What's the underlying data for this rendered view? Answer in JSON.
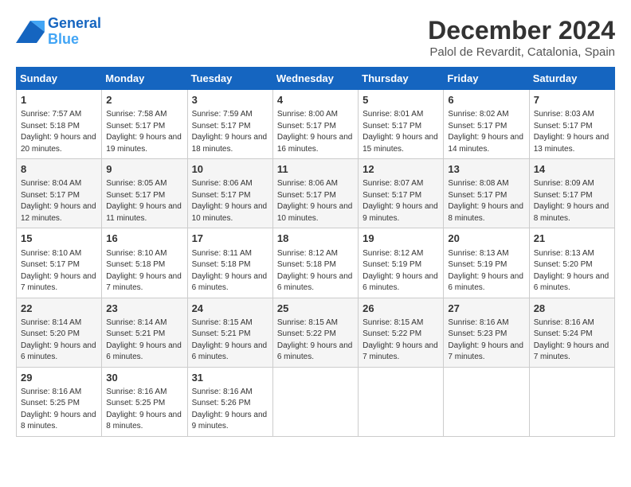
{
  "logo": {
    "line1": "General",
    "line2": "Blue"
  },
  "title": "December 2024",
  "subtitle": "Palol de Revardit, Catalonia, Spain",
  "days_of_week": [
    "Sunday",
    "Monday",
    "Tuesday",
    "Wednesday",
    "Thursday",
    "Friday",
    "Saturday"
  ],
  "weeks": [
    [
      {
        "day": "1",
        "info": "Sunrise: 7:57 AM\nSunset: 5:18 PM\nDaylight: 9 hours and 20 minutes."
      },
      {
        "day": "2",
        "info": "Sunrise: 7:58 AM\nSunset: 5:17 PM\nDaylight: 9 hours and 19 minutes."
      },
      {
        "day": "3",
        "info": "Sunrise: 7:59 AM\nSunset: 5:17 PM\nDaylight: 9 hours and 18 minutes."
      },
      {
        "day": "4",
        "info": "Sunrise: 8:00 AM\nSunset: 5:17 PM\nDaylight: 9 hours and 16 minutes."
      },
      {
        "day": "5",
        "info": "Sunrise: 8:01 AM\nSunset: 5:17 PM\nDaylight: 9 hours and 15 minutes."
      },
      {
        "day": "6",
        "info": "Sunrise: 8:02 AM\nSunset: 5:17 PM\nDaylight: 9 hours and 14 minutes."
      },
      {
        "day": "7",
        "info": "Sunrise: 8:03 AM\nSunset: 5:17 PM\nDaylight: 9 hours and 13 minutes."
      }
    ],
    [
      {
        "day": "8",
        "info": "Sunrise: 8:04 AM\nSunset: 5:17 PM\nDaylight: 9 hours and 12 minutes."
      },
      {
        "day": "9",
        "info": "Sunrise: 8:05 AM\nSunset: 5:17 PM\nDaylight: 9 hours and 11 minutes."
      },
      {
        "day": "10",
        "info": "Sunrise: 8:06 AM\nSunset: 5:17 PM\nDaylight: 9 hours and 10 minutes."
      },
      {
        "day": "11",
        "info": "Sunrise: 8:06 AM\nSunset: 5:17 PM\nDaylight: 9 hours and 10 minutes."
      },
      {
        "day": "12",
        "info": "Sunrise: 8:07 AM\nSunset: 5:17 PM\nDaylight: 9 hours and 9 minutes."
      },
      {
        "day": "13",
        "info": "Sunrise: 8:08 AM\nSunset: 5:17 PM\nDaylight: 9 hours and 8 minutes."
      },
      {
        "day": "14",
        "info": "Sunrise: 8:09 AM\nSunset: 5:17 PM\nDaylight: 9 hours and 8 minutes."
      }
    ],
    [
      {
        "day": "15",
        "info": "Sunrise: 8:10 AM\nSunset: 5:17 PM\nDaylight: 9 hours and 7 minutes."
      },
      {
        "day": "16",
        "info": "Sunrise: 8:10 AM\nSunset: 5:18 PM\nDaylight: 9 hours and 7 minutes."
      },
      {
        "day": "17",
        "info": "Sunrise: 8:11 AM\nSunset: 5:18 PM\nDaylight: 9 hours and 6 minutes."
      },
      {
        "day": "18",
        "info": "Sunrise: 8:12 AM\nSunset: 5:18 PM\nDaylight: 9 hours and 6 minutes."
      },
      {
        "day": "19",
        "info": "Sunrise: 8:12 AM\nSunset: 5:19 PM\nDaylight: 9 hours and 6 minutes."
      },
      {
        "day": "20",
        "info": "Sunrise: 8:13 AM\nSunset: 5:19 PM\nDaylight: 9 hours and 6 minutes."
      },
      {
        "day": "21",
        "info": "Sunrise: 8:13 AM\nSunset: 5:20 PM\nDaylight: 9 hours and 6 minutes."
      }
    ],
    [
      {
        "day": "22",
        "info": "Sunrise: 8:14 AM\nSunset: 5:20 PM\nDaylight: 9 hours and 6 minutes."
      },
      {
        "day": "23",
        "info": "Sunrise: 8:14 AM\nSunset: 5:21 PM\nDaylight: 9 hours and 6 minutes."
      },
      {
        "day": "24",
        "info": "Sunrise: 8:15 AM\nSunset: 5:21 PM\nDaylight: 9 hours and 6 minutes."
      },
      {
        "day": "25",
        "info": "Sunrise: 8:15 AM\nSunset: 5:22 PM\nDaylight: 9 hours and 6 minutes."
      },
      {
        "day": "26",
        "info": "Sunrise: 8:15 AM\nSunset: 5:22 PM\nDaylight: 9 hours and 7 minutes."
      },
      {
        "day": "27",
        "info": "Sunrise: 8:16 AM\nSunset: 5:23 PM\nDaylight: 9 hours and 7 minutes."
      },
      {
        "day": "28",
        "info": "Sunrise: 8:16 AM\nSunset: 5:24 PM\nDaylight: 9 hours and 7 minutes."
      }
    ],
    [
      {
        "day": "29",
        "info": "Sunrise: 8:16 AM\nSunset: 5:25 PM\nDaylight: 9 hours and 8 minutes."
      },
      {
        "day": "30",
        "info": "Sunrise: 8:16 AM\nSunset: 5:25 PM\nDaylight: 9 hours and 8 minutes."
      },
      {
        "day": "31",
        "info": "Sunrise: 8:16 AM\nSunset: 5:26 PM\nDaylight: 9 hours and 9 minutes."
      },
      null,
      null,
      null,
      null
    ]
  ]
}
